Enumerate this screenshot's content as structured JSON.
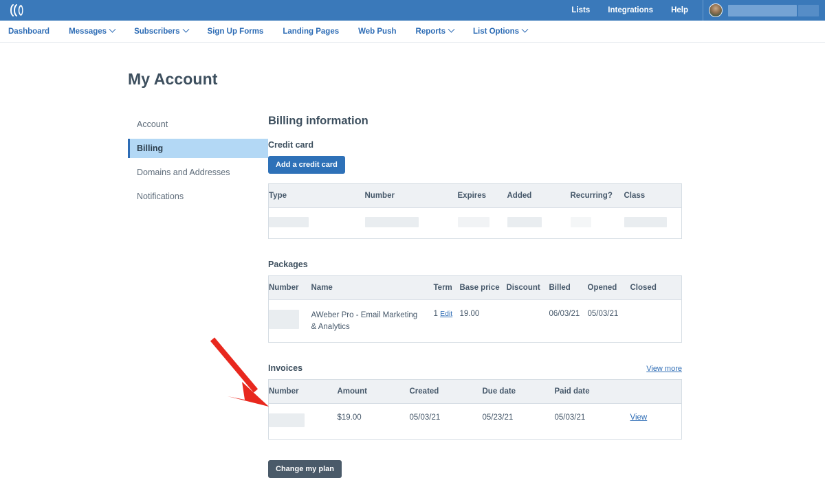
{
  "brand": {
    "logo_icon": "aweber-logo-icon",
    "primary": "#3a79ba",
    "accent": "#2d6cb5",
    "dark_button": "#4a5a69"
  },
  "topbar": {
    "links": [
      {
        "label": "Lists",
        "name": "lists"
      },
      {
        "label": "Integrations",
        "name": "integrations"
      },
      {
        "label": "Help",
        "name": "help"
      }
    ],
    "account": {
      "avatar_icon": "user-avatar",
      "name_redacted": true
    }
  },
  "nav": {
    "items": [
      {
        "label": "Dashboard",
        "has_caret": false
      },
      {
        "label": "Messages",
        "has_caret": true
      },
      {
        "label": "Subscribers",
        "has_caret": true
      },
      {
        "label": "Sign Up Forms",
        "has_caret": false
      },
      {
        "label": "Landing Pages",
        "has_caret": false
      },
      {
        "label": "Web Push",
        "has_caret": false
      },
      {
        "label": "Reports",
        "has_caret": true
      },
      {
        "label": "List Options",
        "has_caret": true
      }
    ]
  },
  "page": {
    "title": "My Account"
  },
  "sidebar": {
    "items": [
      {
        "label": "Account",
        "active": false
      },
      {
        "label": "Billing",
        "active": true
      },
      {
        "label": "Domains and Addresses",
        "active": false
      },
      {
        "label": "Notifications",
        "active": false
      }
    ]
  },
  "main": {
    "heading": "Billing information",
    "credit_card": {
      "sub_heading": "Credit card",
      "add_button": "Add a credit card",
      "columns": [
        "Type",
        "Number",
        "Expires",
        "Added",
        "Recurring?",
        "Class"
      ],
      "rows": [
        {
          "type": "",
          "number": "",
          "expires": "",
          "added": "",
          "recurring": "",
          "class": "",
          "redacted": true
        }
      ]
    },
    "packages": {
      "sub_heading": "Packages",
      "columns": [
        "Number",
        "Name",
        "Term",
        "Base price",
        "Discount",
        "Billed",
        "Opened",
        "Closed"
      ],
      "rows": [
        {
          "number": "",
          "number_redacted": true,
          "name": "AWeber Pro - Email Marketing & Analytics",
          "term": "1",
          "term_edit_link": "Edit",
          "base_price": "19.00",
          "discount": "",
          "billed": "06/03/21",
          "opened": "05/03/21",
          "closed": ""
        }
      ]
    },
    "invoices": {
      "sub_heading": "Invoices",
      "view_more": "View more",
      "columns": [
        "Number",
        "Amount",
        "Created",
        "Due date",
        "Paid date",
        ""
      ],
      "rows": [
        {
          "number": "",
          "number_redacted": true,
          "amount": "$19.00",
          "created": "05/03/21",
          "due_date": "05/23/21",
          "paid_date": "05/03/21",
          "action": "View"
        }
      ]
    },
    "change_plan_button": "Change my plan"
  },
  "annotation": {
    "arrow_color": "#e8281e",
    "points_to": "change-my-plan-button"
  }
}
